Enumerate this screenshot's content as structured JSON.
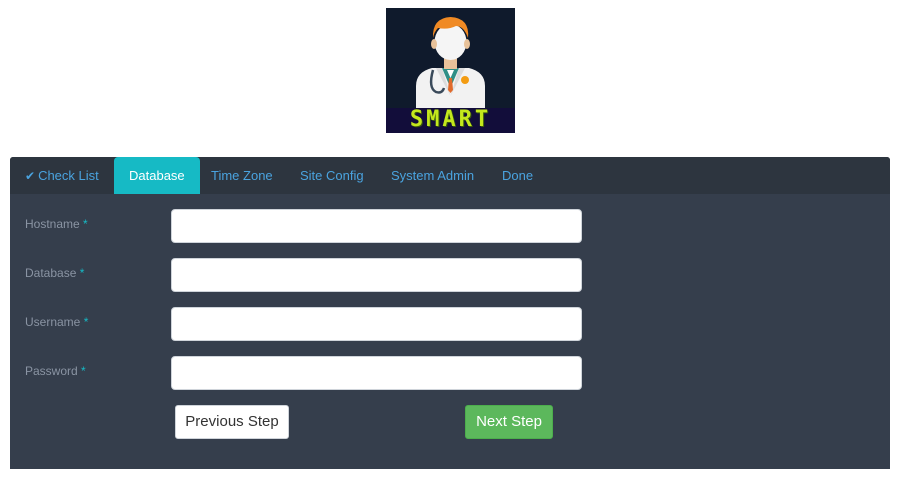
{
  "logo": {
    "text": "SMART",
    "icon": "doctor-avatar-icon"
  },
  "tabs": [
    {
      "label": "Check List",
      "icon": "checkmark-icon",
      "state": "completed"
    },
    {
      "label": "Database",
      "state": "active"
    },
    {
      "label": "Time Zone",
      "state": "pending"
    },
    {
      "label": "Site Config",
      "state": "pending"
    },
    {
      "label": "System Admin",
      "state": "pending"
    },
    {
      "label": "Done",
      "state": "pending"
    }
  ],
  "form": {
    "required_marker": "*",
    "fields": [
      {
        "label": "Hostname",
        "value": ""
      },
      {
        "label": "Database",
        "value": ""
      },
      {
        "label": "Username",
        "value": ""
      },
      {
        "label": "Password",
        "value": ""
      }
    ]
  },
  "buttons": {
    "previous": "Previous Step",
    "next": "Next Step"
  },
  "colors": {
    "accent": "#16bac5",
    "panel": "#353e4c",
    "tabbar": "#2d353f",
    "link": "#4aa3df",
    "success": "#5cb85c"
  }
}
